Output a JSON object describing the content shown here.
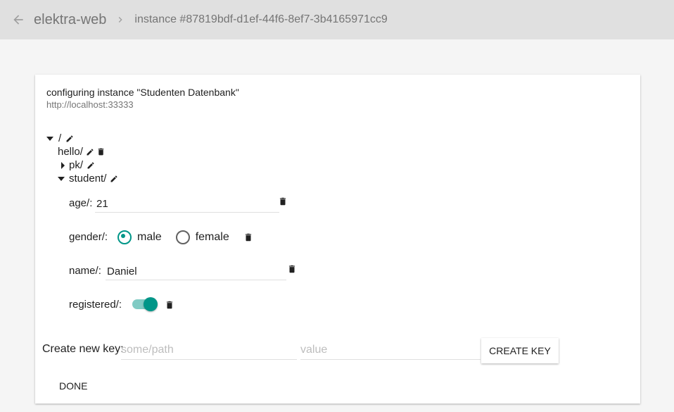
{
  "header": {
    "app_title": "elektra-web",
    "breadcrumb_current": "instance #87819bdf-d1ef-44f6-8ef7-3b4165971cc9"
  },
  "card": {
    "title": "configuring instance \"Studenten Datenbank\"",
    "subtitle": "http://localhost:33333"
  },
  "tree": {
    "root": {
      "label": "/",
      "expanded": true
    },
    "hello": {
      "label": "hello/"
    },
    "pk": {
      "label": "pk/",
      "expanded": false
    },
    "student": {
      "label": "student/",
      "expanded": true
    }
  },
  "fields": {
    "age": {
      "label": "age/:",
      "value": "21"
    },
    "gender": {
      "label": "gender/:",
      "options": [
        {
          "label": "male",
          "checked": true
        },
        {
          "label": "female",
          "checked": false
        }
      ]
    },
    "name": {
      "label": "name/:",
      "value": "Daniel"
    },
    "registered": {
      "label": "registered/:",
      "on": true
    }
  },
  "create": {
    "label": "Create new key:",
    "path_placeholder": "some/path",
    "value_placeholder": "value",
    "button": "CREATE KEY"
  },
  "done_button": "DONE",
  "colors": {
    "accent": "#009688",
    "accent_light": "#80cbc4",
    "header_bg": "#e0e0e0"
  },
  "icons": {
    "back": "arrow-back-icon",
    "breadcrumb_separator": "chevron-right-icon",
    "edit": "pencil-icon",
    "delete": "trash-icon",
    "expanded": "caret-down-icon",
    "collapsed": "caret-right-icon"
  }
}
